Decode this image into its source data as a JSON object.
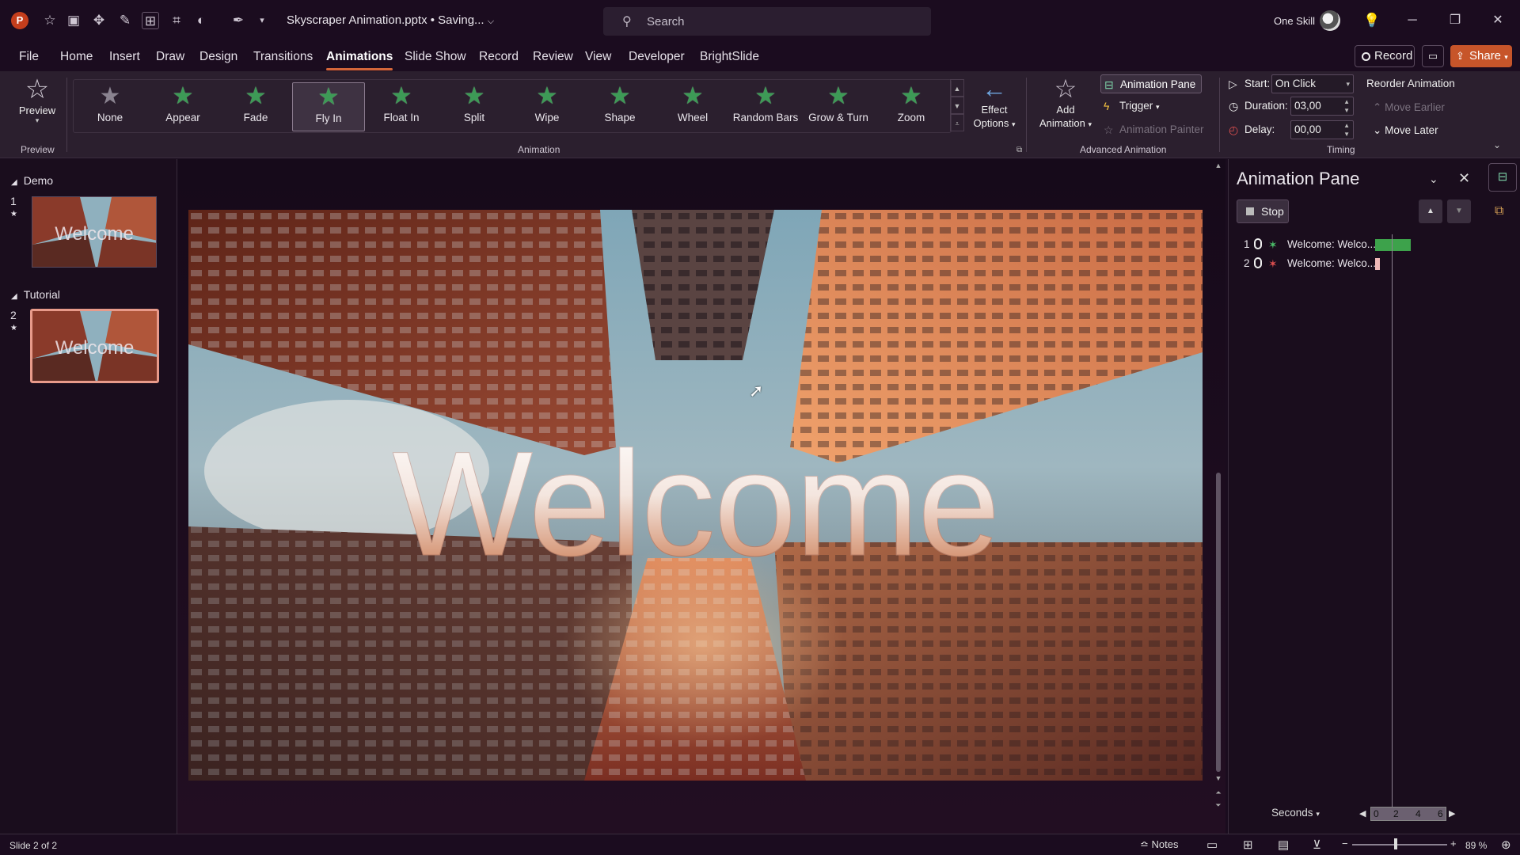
{
  "titlebar": {
    "document_title": "Skyscraper Animation.pptx • Saving...",
    "search_placeholder": "Search",
    "user_name": "One Skill"
  },
  "menu": {
    "tabs": [
      "File",
      "Home",
      "Insert",
      "Draw",
      "Design",
      "Transitions",
      "Animations",
      "Slide Show",
      "Record",
      "Review",
      "View",
      "Developer",
      "BrightSlide"
    ],
    "active_tab": "Animations",
    "record_label": "Record",
    "share_label": "Share"
  },
  "ribbon": {
    "preview_label": "Preview",
    "preview_group": "Preview",
    "animation_group": "Animation",
    "animations": [
      "None",
      "Appear",
      "Fade",
      "Fly In",
      "Float In",
      "Split",
      "Wipe",
      "Shape",
      "Wheel",
      "Random Bars",
      "Grow & Turn",
      "Zoom"
    ],
    "selected_animation": "Fly In",
    "effect_options_line1": "Effect",
    "effect_options_line2": "Options",
    "add_animation_line1": "Add",
    "add_animation_line2": "Animation",
    "animation_pane_label": "Animation Pane",
    "trigger_label": "Trigger",
    "animation_painter_label": "Animation Painter",
    "advanced_group": "Advanced Animation",
    "start_label": "Start:",
    "start_value": "On Click",
    "duration_label": "Duration:",
    "duration_value": "03,00",
    "delay_label": "Delay:",
    "delay_value": "00,00",
    "timing_group": "Timing",
    "reorder_label": "Reorder Animation",
    "move_earlier_label": "Move Earlier",
    "move_later_label": "Move Later"
  },
  "sidebar": {
    "sections": [
      {
        "name": "Demo",
        "slide_number": "1",
        "thumb_text": "Welcome"
      },
      {
        "name": "Tutorial",
        "slide_number": "2",
        "thumb_text": "Welcome"
      }
    ],
    "active_slide": 2
  },
  "slide": {
    "title_text": "Welcome"
  },
  "animation_pane": {
    "title": "Animation Pane",
    "stop_label": "Stop",
    "items": [
      {
        "number": "1",
        "name": "Welcome: Welco...",
        "bar_color": "#3da24b"
      },
      {
        "number": "2",
        "name": "Welcome: Welco...",
        "bar_color": "#f0b8b8"
      }
    ],
    "seconds_label": "Seconds",
    "ruler_ticks": [
      "0",
      "2",
      "4",
      "6"
    ]
  },
  "status": {
    "slide_count": "Slide 2 of 2",
    "notes_label": "Notes",
    "zoom": "89 %"
  },
  "colors": {
    "accent": "#d4663a",
    "share": "#c7552a",
    "selected_thumb_border": "#e89a8a"
  }
}
